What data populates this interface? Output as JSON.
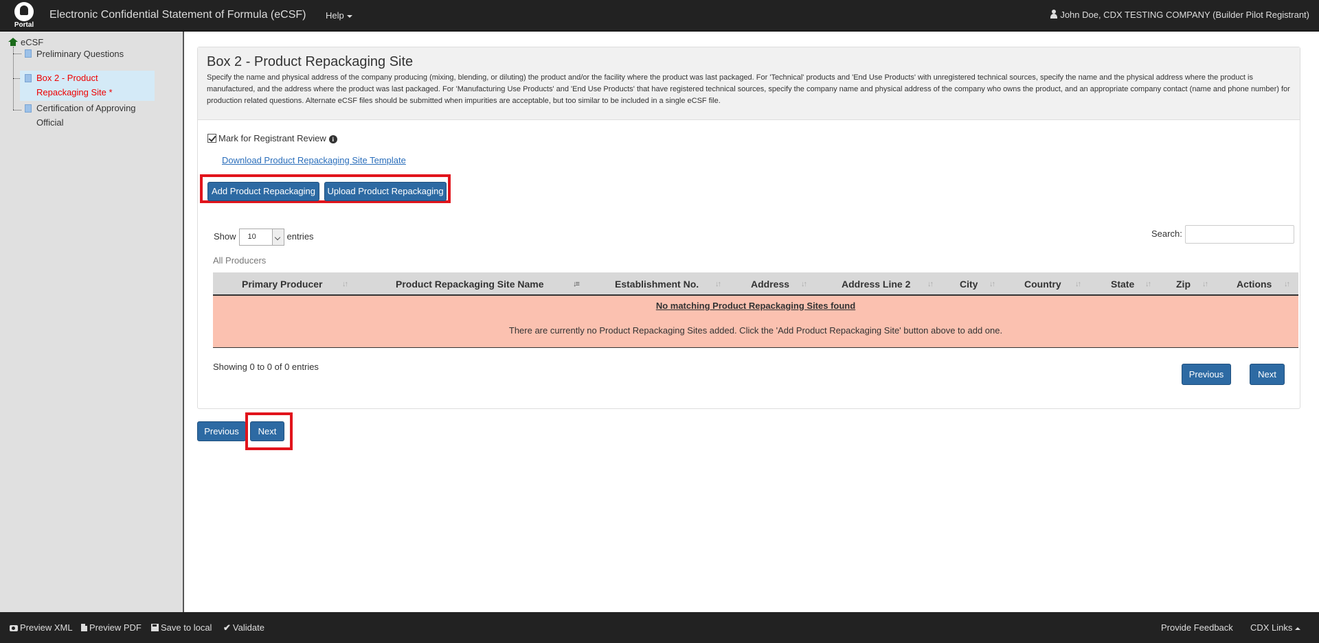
{
  "header": {
    "logo_text": "Portal",
    "app_title": "Electronic Confidential Statement of Formula (eCSF)",
    "help_label": "Help",
    "user_label": "John Doe, CDX TESTING COMPANY (Builder Pilot Registrant)"
  },
  "sidebar": {
    "root_label": "eCSF",
    "items": [
      {
        "label_line1": "Preliminary Questions",
        "label_line2": ""
      },
      {
        "label_line1": "Box 2 - Product",
        "label_line2": "Repackaging Site *"
      },
      {
        "label_line1": "Certification of Approving",
        "label_line2": "Official"
      }
    ]
  },
  "panel": {
    "title": "Box 2 - Product Repackaging Site",
    "description": "Specify the name and physical address of the company producing (mixing, blending, or diluting) the product and/or the facility where the product was last packaged. For 'Technical' products and 'End Use Products' with unregistered technical sources, specify the name and the physical address where the product is manufactured, and the address where the product was last packaged. For 'Manufacturing Use Products' and 'End Use Products' that have registered technical sources, specify the company name and physical address of the company who owns the product, and an appropriate company contact (name and phone number) for production related questions. Alternate eCSF files should be submitted when impurities are acceptable, but too similar to be included in a single eCSF file.",
    "mark_review_label": "Mark for Registrant Review",
    "download_link": "Download Product Repackaging Site Template",
    "add_button": "Add Product Repackaging Site",
    "upload_button": "Upload Product Repackaging Site"
  },
  "table": {
    "show_label": "Show",
    "page_size": "10",
    "entries_label": "entries",
    "search_label": "Search:",
    "search_value": "",
    "caption": "All Producers",
    "columns": [
      "Primary Producer",
      "Product Repackaging Site Name",
      "Establishment No.",
      "Address",
      "Address Line 2",
      "City",
      "Country",
      "State",
      "Zip",
      "Actions"
    ],
    "empty_title": "No matching Product Repackaging Sites found",
    "empty_message": "There are currently no Product Repackaging Sites added. Click the 'Add Product Repackaging Site' button above to add one.",
    "info": "Showing 0 to 0 of 0 entries",
    "prev_label": "Previous",
    "next_label": "Next"
  },
  "page_nav": {
    "prev_label": "Previous",
    "next_label": "Next"
  },
  "footer": {
    "preview_xml": "Preview XML",
    "preview_pdf": "Preview PDF",
    "save_local": "Save to local",
    "validate": "Validate",
    "feedback": "Provide Feedback",
    "cdx_links": "CDX Links"
  },
  "colors": {
    "primary_button": "#2d6aa3",
    "highlight": "#e1141c",
    "empty_row": "#fbc1b0",
    "nav_bg": "#222222",
    "active_node_text": "#ee0000"
  }
}
